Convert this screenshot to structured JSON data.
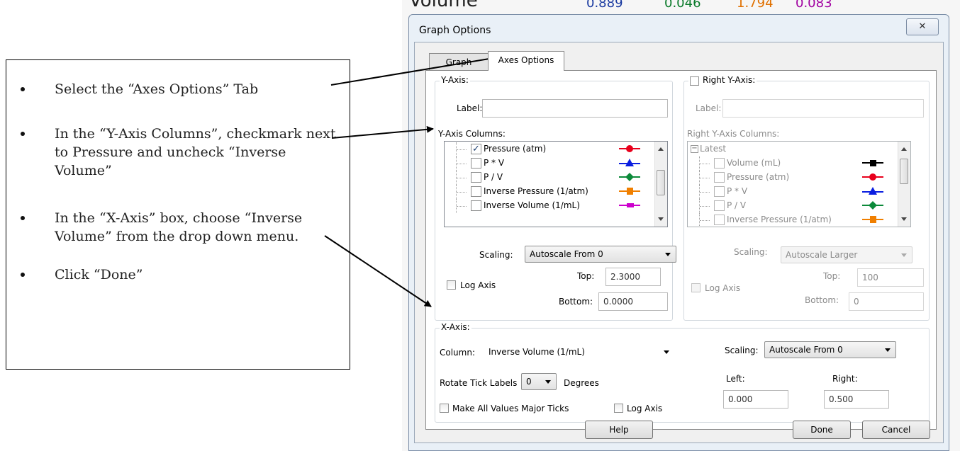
{
  "instructions": {
    "items": [
      "Select the “Axes Options” Tab",
      "In the “Y-Axis Columns”, checkmark next to Pressure and uncheck “Inverse Volume”",
      "In the “X-Axis” box, choose “Inverse Volume” from the drop down menu.",
      "Click “Done”"
    ]
  },
  "background": {
    "title_fragment": "Volume",
    "cells": [
      "0.889",
      "0.046",
      "1.794",
      "0.083"
    ]
  },
  "dialog": {
    "title": "Graph Options",
    "close_glyph": "✕",
    "tabs": [
      "Graph Options",
      "Axes Options"
    ],
    "active_tab": "Axes Options",
    "y_axis": {
      "group_label": "Y-Axis:",
      "label_caption": "Label:",
      "label_value": "",
      "columns_caption": "Y-Axis Columns:",
      "columns": [
        {
          "name": "Pressure (atm)",
          "checked": "✓",
          "color": "#e8001c",
          "marker": "circle"
        },
        {
          "name": "P * V",
          "checked": "",
          "color": "#0a1ee0",
          "marker": "triangle"
        },
        {
          "name": "P / V",
          "checked": "",
          "color": "#0c8a3a",
          "marker": "diamond"
        },
        {
          "name": "Inverse Pressure (1/atm)",
          "checked": "",
          "color": "#f07f00",
          "marker": "square"
        },
        {
          "name": "Inverse Volume (1/mL)",
          "checked": "",
          "color": "#cc00cc",
          "marker": "square"
        }
      ],
      "scaling_caption": "Scaling:",
      "scaling_value": "Autoscale From 0",
      "log_axis": "Log Axis",
      "top_caption": "Top:",
      "top_value": "2.3000",
      "bottom_caption": "Bottom:",
      "bottom_value": "0.0000"
    },
    "right_y_axis": {
      "group_label": "Right Y-Axis:",
      "label_caption": "Label:",
      "label_value": "",
      "columns_caption": "Right Y-Axis Columns:",
      "root": "Latest",
      "columns": [
        {
          "name": "Volume (mL)",
          "color": "#000000",
          "marker": "square"
        },
        {
          "name": "Pressure (atm)",
          "color": "#e8001c",
          "marker": "circle"
        },
        {
          "name": "P * V",
          "color": "#0a1ee0",
          "marker": "triangle"
        },
        {
          "name": "P / V",
          "color": "#0c8a3a",
          "marker": "diamond"
        },
        {
          "name": "Inverse Pressure (1/atm)",
          "color": "#f07f00",
          "marker": "square"
        }
      ],
      "scaling_caption": "Scaling:",
      "scaling_value": "Autoscale Larger",
      "log_axis": "Log Axis",
      "top_caption": "Top:",
      "top_value": "100",
      "bottom_caption": "Bottom:",
      "bottom_value": "0"
    },
    "x_axis": {
      "group_label": "X-Axis:",
      "column_caption": "Column:",
      "column_value": "Inverse Volume (1/mL)",
      "rotate_caption": "Rotate Tick Labels",
      "rotate_value": "0",
      "degrees": "Degrees",
      "major_ticks": "Make All Values Major Ticks",
      "log_axis": "Log Axis",
      "scaling_caption": "Scaling:",
      "scaling_value": "Autoscale From 0",
      "left_caption": "Left:",
      "left_value": "0.000",
      "right_caption": "Right:",
      "right_value": "0.500"
    },
    "buttons": {
      "help": "Help",
      "done": "Done",
      "cancel": "Cancel"
    }
  }
}
